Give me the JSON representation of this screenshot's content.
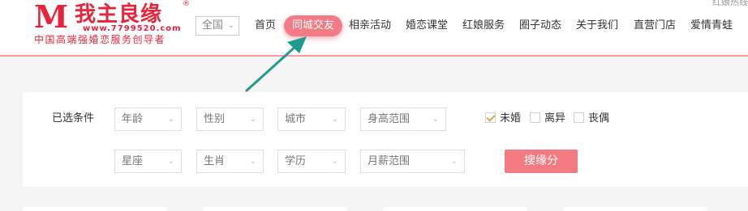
{
  "logo": {
    "mark": "M",
    "name": "我主良缘",
    "registered": "®",
    "url": "www.7799520.com",
    "slogan": "中国高端强婚恋服务创导者"
  },
  "city_select": {
    "value": "全国"
  },
  "nav": [
    {
      "label": "首页"
    },
    {
      "label": "同城交友",
      "active": true
    },
    {
      "label": "相亲活动"
    },
    {
      "label": "婚恋课堂"
    },
    {
      "label": "红娘服务"
    },
    {
      "label": "圈子动态"
    },
    {
      "label": "关于我们"
    },
    {
      "label": "直营门店"
    },
    {
      "label": "爱情青蛙"
    }
  ],
  "corner_text": "红娘热线",
  "filters": {
    "label": "已选条件",
    "row1": [
      "年龄",
      "性别",
      "城市",
      "身高范围"
    ],
    "row2": [
      "星座",
      "生肖",
      "学历",
      "月薪范围"
    ],
    "marital": [
      {
        "label": "未婚",
        "checked": true
      },
      {
        "label": "离异",
        "checked": false
      },
      {
        "label": "丧偶",
        "checked": false
      }
    ],
    "search_button": "搜缘分"
  },
  "colors": {
    "brand": "#e8243a",
    "accent": "#f47a85",
    "arrow": "#1f9a8e"
  },
  "icons": [
    "chevron-down-icon",
    "arrow-icon",
    "checkbox-icon"
  ]
}
